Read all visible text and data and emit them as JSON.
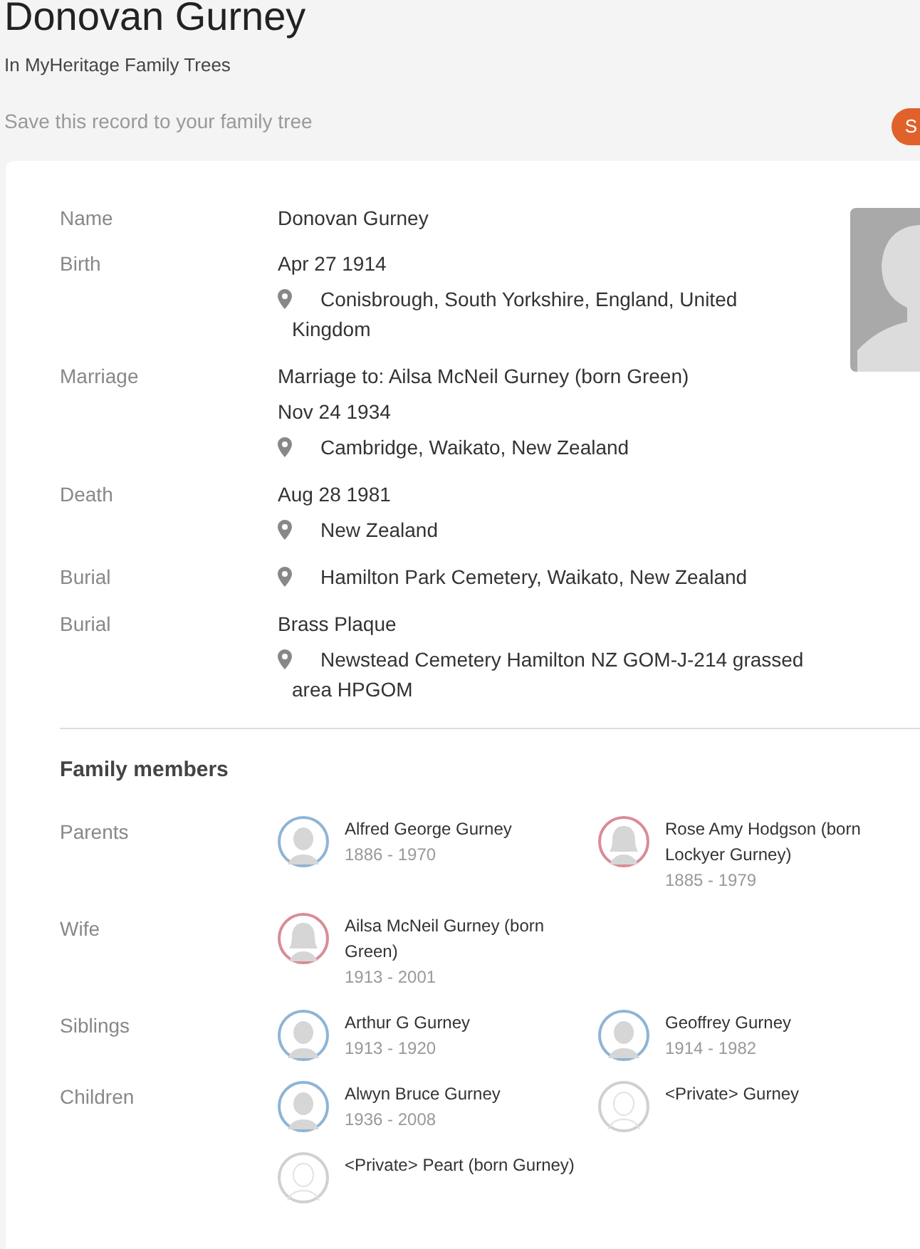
{
  "header": {
    "title": "Donovan Gurney",
    "subtitle": "In MyHeritage Family Trees",
    "save_prompt": "Save this record to your family tree",
    "save_button": "S"
  },
  "facts": [
    {
      "label": "Name",
      "lines": [
        {
          "kind": "text",
          "text": "Donovan Gurney"
        }
      ]
    },
    {
      "label": "Birth",
      "lines": [
        {
          "kind": "text",
          "text": "Apr 27 1914"
        },
        {
          "kind": "place",
          "text": "Conisbrough, South Yorkshire, England, United Kingdom"
        }
      ]
    },
    {
      "label": "Marriage",
      "lines": [
        {
          "kind": "text",
          "text": "Marriage to: Ailsa McNeil Gurney (born Green)"
        },
        {
          "kind": "text",
          "text": "Nov 24 1934"
        },
        {
          "kind": "place",
          "text": "Cambridge, Waikato, New Zealand"
        }
      ]
    },
    {
      "label": "Death",
      "lines": [
        {
          "kind": "text",
          "text": "Aug 28 1981"
        },
        {
          "kind": "place",
          "text": "New Zealand"
        }
      ]
    },
    {
      "label": "Burial",
      "lines": [
        {
          "kind": "place",
          "text": "Hamilton Park Cemetery, Waikato, New Zealand"
        }
      ]
    },
    {
      "label": "Burial",
      "lines": [
        {
          "kind": "text",
          "text": "Brass Plaque"
        },
        {
          "kind": "place",
          "text": "Newstead Cemetery Hamilton NZ GOM-J-214 grassed area HPGOM"
        }
      ]
    }
  ],
  "family": {
    "heading": "Family members",
    "groups": [
      {
        "label": "Parents",
        "members": [
          {
            "name": "Alfred George Gurney",
            "years": "1886 - 1970",
            "kind": "male"
          },
          {
            "name": "Rose Amy Hodgson (born Lockyer Gurney)",
            "years": "1885 - 1979",
            "kind": "female"
          }
        ]
      },
      {
        "label": "Wife",
        "members": [
          {
            "name": "Ailsa McNeil Gurney (born Green)",
            "years": "1913 - 2001",
            "kind": "female"
          }
        ]
      },
      {
        "label": "Siblings",
        "members": [
          {
            "name": "Arthur G Gurney",
            "years": "1913 - 1920",
            "kind": "male"
          },
          {
            "name": "Geoffrey Gurney",
            "years": "1914 - 1982",
            "kind": "male"
          }
        ]
      },
      {
        "label": "Children",
        "members": [
          {
            "name": "Alwyn Bruce Gurney",
            "years": "1936 - 2008",
            "kind": "male"
          },
          {
            "name": "<Private> Gurney",
            "kind": "unknown"
          },
          {
            "name": "<Private> Peart (born Gurney)",
            "kind": "unknown"
          }
        ]
      }
    ]
  }
}
